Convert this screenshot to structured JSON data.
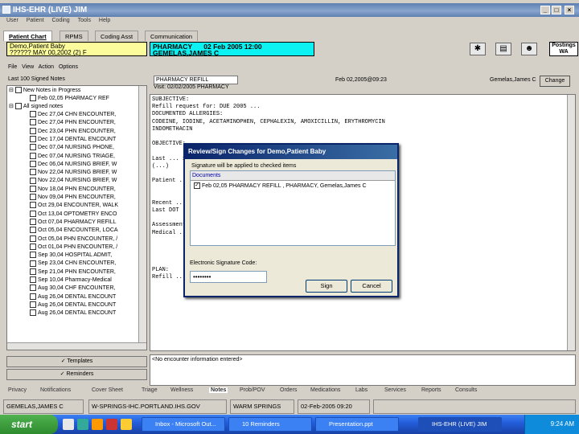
{
  "window": {
    "title": "IHS-EHR (LIVE) JIM"
  },
  "menu": [
    "User",
    "Patient",
    "Coding",
    "Tools",
    "Help"
  ],
  "tabs": [
    "Patient Chart",
    "RPMS",
    "Coding Asst",
    "Communication"
  ],
  "patient": {
    "name": "Demo,Patient Baby",
    "line2": "??????   MAY 00,2002 (2)   F"
  },
  "encounter": {
    "location": "PHARMACY",
    "datetime": "02 Feb 2005 12:00",
    "provider": "GEMELAS,JAMES C"
  },
  "postings": {
    "line1": "Postings",
    "line2": "WA"
  },
  "notes_menu": [
    "File",
    "View",
    "Action",
    "Options"
  ],
  "left_header": "Last 100 Signed Notes",
  "tree": {
    "in_progress": "New Notes in Progress",
    "in_progress_item": "Feb 02,05 PHARMACY REF",
    "all_signed": "All signed notes",
    "notes": [
      "Dec 27,04 CHN ENCOUNTER,",
      "Dec 27,04 PHN ENCOUNTER,",
      "Dec 23,04 PHN ENCOUNTER,",
      "Dec 17,04 DENTAL ENCOUNT",
      "Dec 07,04 NURSING PHONE,",
      "Dec 07,04 NURSING TRIAGE,",
      "Dec 06,04 NURSING BRIEF, W",
      "Nov 22,04 NURSING BRIEF, W",
      "Nov 22,04 NURSING BRIEF, W",
      "Nov 18,04 PHN ENCOUNTER,",
      "Nov 09,04 PHN ENCOUNTER,",
      "Oct 29,04 ENCOUNTER, WALK",
      "Oct 13,04 OPTOMETRY ENCO",
      "Oct 07,04 PHARMACY REFILL",
      "Oct 05,04 ENCOUNTER, LOCA",
      "Oct 05,04 PHN ENCOUNTER, /",
      "Oct 01,04 PHN ENCOUNTER, /",
      "Sep 30,04 HOSPITAL ADMIT,",
      "Sep 23,04 CHN ENCOUNTER,",
      "Sep 21,04 PHN ENCOUNTER,",
      "Sep 10,04 Pharmacy-Medical",
      "Aug 30,04 CHF ENCOUNTER,",
      "Aug 26,04 DENTAL ENCOUNT",
      "Aug 26,04 DENTAL ENCOUNT",
      "Aug 26,04 DENTAL ENCOUNT"
    ]
  },
  "templates_btn": "Templates",
  "reminders_btn": "Reminders",
  "note_header": {
    "title": "PHARMACY REFILL",
    "sub": "Visit: 02/02/2005 PHARMACY",
    "date": "Feb 02,2005@09:23",
    "author": "Gemelas,James C",
    "change_btn": "Change"
  },
  "note_lines": [
    "SUBJECTIVE:",
    "Refill request for:  DUE 2005 ... ",
    "DOCUMENTED ALLERGIES:",
    "CODEINE, IODINE, ACETAMINOPHEN, CEPHALEXIN, AMOXICILLIN, ERYTHROMYCIN",
    "INDOMETHACIN",
    "",
    "OBJECTIVE:",
    "",
    "   Last ...                                                        11/04/2005",
    "(...)",
    "",
    "Patient ...",
    "",
    "",
    "Recent ...",
    "Last DOT ...",
    "",
    "Assessment ...",
    "Medical ...",
    "",
    "",
    "",
    "",
    "PLAN:",
    "Refill ..."
  ],
  "no_sign_text": "<No encounter information entered>",
  "bottom_tabs": [
    "Privacy",
    "Notifications",
    "Cover Sheet",
    "Triage",
    "Wellness",
    "Notes",
    "Prob/POV",
    "Orders",
    "Medications",
    "Labs",
    "Services",
    "Reports",
    "Consults"
  ],
  "status": {
    "user": "GEMELAS,JAMES C",
    "server": "W-SPRINGS-IHC.PORTLAND.IHS.GOV",
    "site": "WARM SPRINGS",
    "datetime": "02-Feb-2005 09:20"
  },
  "dialog": {
    "title": "Review/Sign Changes for Demo,Patient Baby",
    "note": "Signature will be applied to checked items",
    "list_header": "Documents",
    "item": "Feb 02,05  PHARMACY REFILL , PHARMACY, Gemelas,James C",
    "esig_label": "Electronic Signature Code:",
    "esig_value": "••••••••",
    "sign_btn": "Sign",
    "cancel_btn": "Cancel"
  },
  "taskbar": {
    "start": "start",
    "buttons": [
      "Inbox - Microsoft Out...",
      "10 Reminders",
      "Presentation.ppt",
      "IHS-EHR (LIVE) JIM"
    ],
    "clock": "9:24 AM"
  }
}
